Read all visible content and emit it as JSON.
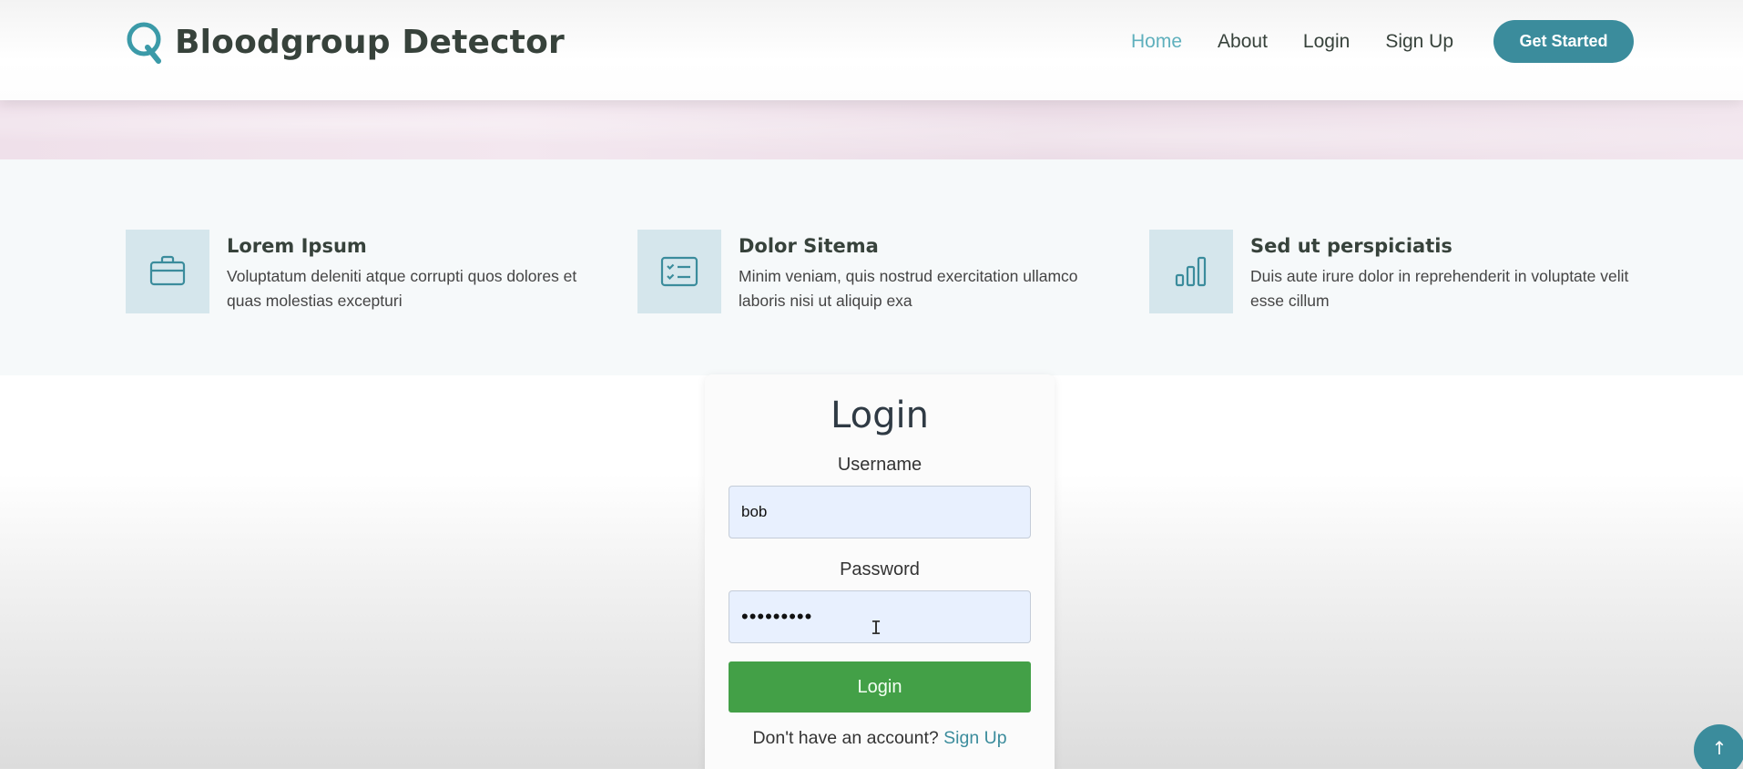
{
  "brand": {
    "title": "Bloodgroup Detector",
    "logo_icon": "q-logo-icon",
    "logo_color": "#3b9aa8"
  },
  "nav": {
    "items": [
      {
        "label": "Home",
        "active": true
      },
      {
        "label": "About",
        "active": false
      },
      {
        "label": "Login",
        "active": false
      },
      {
        "label": "Sign Up",
        "active": false
      }
    ],
    "cta_label": "Get Started"
  },
  "features": [
    {
      "icon": "briefcase-icon",
      "title": "Lorem Ipsum",
      "description": "Voluptatum deleniti atque corrupti quos dolores et quas molestias excepturi"
    },
    {
      "icon": "checklist-icon",
      "title": "Dolor Sitema",
      "description": "Minim veniam, quis nostrud exercitation ullamco laboris nisi ut aliquip exa"
    },
    {
      "icon": "bar-chart-icon",
      "title": "Sed ut perspiciatis",
      "description": "Duis aute irure dolor in reprehenderit in voluptate velit esse cillum"
    }
  ],
  "login": {
    "title": "Login",
    "username_label": "Username",
    "username_value": "bob",
    "password_label": "Password",
    "password_value": "•••••••••",
    "submit_label": "Login",
    "signup_prompt": "Don't have an account?",
    "signup_link": "Sign Up"
  },
  "back_to_top": {
    "icon": "arrow-up-icon",
    "glyph": "↑"
  },
  "colors": {
    "accent": "#3b8c9c",
    "nav_active": "#5fb0bd",
    "login_button": "#43a047",
    "input_bg": "#e8f0fe",
    "feature_icon_bg": "#d5e6ec"
  }
}
